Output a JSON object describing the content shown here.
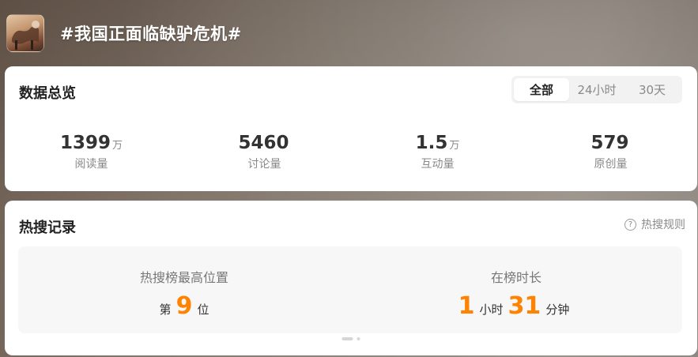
{
  "topic": {
    "title": "#我国正面临缺驴危机#",
    "thumbnail_icon": "donkey-photo-thumbnail"
  },
  "overview": {
    "title": "数据总览",
    "tabs": [
      {
        "label": "全部",
        "active": true
      },
      {
        "label": "24小时",
        "active": false
      },
      {
        "label": "30天",
        "active": false
      }
    ],
    "stats": [
      {
        "value": "1399",
        "unit": "万",
        "label": "阅读量"
      },
      {
        "value": "5460",
        "unit": "",
        "label": "讨论量"
      },
      {
        "value": "1.5",
        "unit": "万",
        "label": "互动量"
      },
      {
        "value": "579",
        "unit": "",
        "label": "原创量"
      }
    ]
  },
  "hot_search": {
    "title": "热搜记录",
    "rules_label": "热搜规则",
    "rules_icon": "question-circle-icon",
    "peak_position": {
      "label": "热搜榜最高位置",
      "prefix": "第",
      "value": "9",
      "suffix": "位"
    },
    "duration": {
      "label": "在榜时长",
      "hours": "1",
      "hours_unit": "小时",
      "minutes": "31",
      "minutes_unit": "分钟"
    },
    "pager": {
      "pages": 2,
      "current": 1
    }
  },
  "colors": {
    "accent": "#ff8200",
    "card_bg": "#ffffff",
    "record_bg": "#f7f7f7"
  }
}
